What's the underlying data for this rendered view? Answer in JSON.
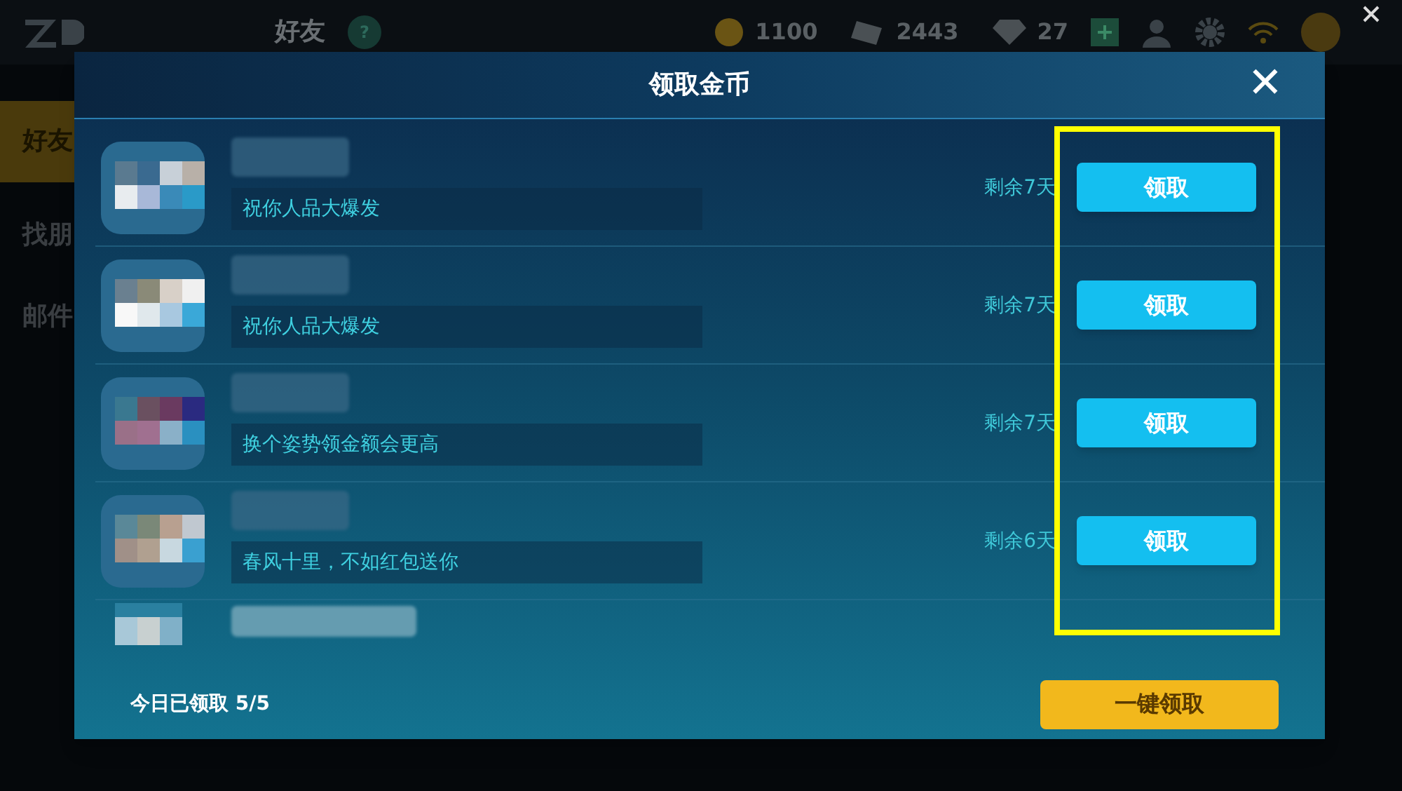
{
  "top_bar": {
    "title": "好友",
    "help": "?",
    "currencies": [
      {
        "kind": "coin",
        "value": "1100"
      },
      {
        "kind": "card",
        "value": "2443"
      },
      {
        "kind": "gem",
        "value": "27"
      }
    ]
  },
  "side_menu": [
    {
      "label": "好友",
      "selected": true
    },
    {
      "label": "找朋",
      "selected": false
    },
    {
      "label": "邮件",
      "selected": false
    }
  ],
  "dialog": {
    "title": "领取金币",
    "close": "✕",
    "rows": [
      {
        "kind": "gift",
        "message": "祝你人品大爆发",
        "remaining": "剩余7天",
        "button": "领取"
      },
      {
        "kind": "gift",
        "message": "祝你人品大爆发",
        "remaining": "剩余7天",
        "button": "领取"
      },
      {
        "kind": "gift",
        "message": "换个姿势领金额会更高",
        "remaining": "剩余7天",
        "button": "领取"
      },
      {
        "kind": "gift",
        "message": "春风十里，不如红包送你",
        "remaining": "剩余6天",
        "button": "领取"
      },
      {
        "kind": "partial"
      }
    ],
    "footer": {
      "status": "今日已领取 5/5",
      "button": "一键领取"
    }
  }
}
